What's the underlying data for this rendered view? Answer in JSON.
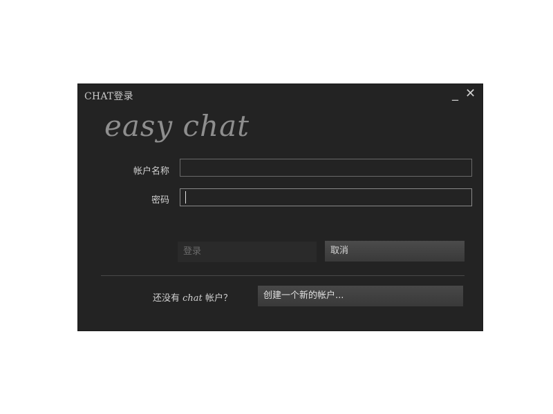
{
  "window": {
    "title": "CHAT登录",
    "minimize_glyph": "_",
    "close_glyph": "✕"
  },
  "logo": {
    "text": "easy chat"
  },
  "form": {
    "account_label": "帐户名称",
    "account_value": "",
    "password_label": "密码",
    "password_value": ""
  },
  "buttons": {
    "login_label": "登录",
    "cancel_label": "取消",
    "create_account_label": "创建一个新的帐户..."
  },
  "signup": {
    "prefix": "还没有",
    "chat_word": "chat",
    "suffix": "帐户？"
  },
  "colors": {
    "window_bg": "#232323",
    "text": "#d2d2d2",
    "disabled_text": "#6b6b6b",
    "border": "#6a6a6a"
  },
  "icons": {
    "minimize": "minimize-icon",
    "close": "close-icon"
  }
}
